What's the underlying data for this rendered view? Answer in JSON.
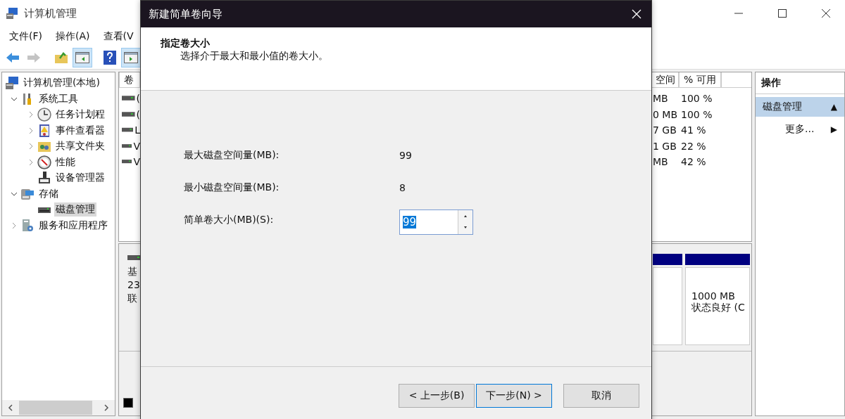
{
  "window": {
    "title": "计算机管理"
  },
  "menu": [
    {
      "label": "文件(F)"
    },
    {
      "label": "操作(A)"
    },
    {
      "label": "查看(V"
    }
  ],
  "toolbar": [
    {
      "pressed": false,
      "disabled": false
    },
    {
      "pressed": false,
      "disabled": true
    },
    {
      "pressed": false,
      "disabled": false
    },
    {
      "pressed": true,
      "disabled": false
    },
    {
      "pressed": false,
      "disabled": false
    },
    {
      "pressed": true,
      "disabled": false
    }
  ],
  "tree": [
    {
      "label": "计算机管理(本地)",
      "selected": false,
      "children": [
        {
          "label": "系统工具",
          "expanded": true,
          "selected": false,
          "children": [
            {
              "label": "任务计划程",
              "expanded": false,
              "selected": false
            },
            {
              "label": "事件查看器",
              "expanded": false,
              "selected": false
            },
            {
              "label": "共享文件夹",
              "expanded": false,
              "selected": false
            },
            {
              "label": "性能",
              "expanded": false,
              "selected": false
            },
            {
              "label": "设备管理器",
              "selected": false
            }
          ]
        },
        {
          "label": "存储",
          "expanded": true,
          "selected": false,
          "children": [
            {
              "label": "磁盘管理",
              "selected": true
            }
          ]
        },
        {
          "label": "服务和应用程序",
          "expanded": false,
          "selected": false
        }
      ]
    }
  ],
  "volumes": {
    "columns": [
      {
        "label": "卷"
      },
      {
        "label": "空间"
      },
      {
        "label": "% 可用"
      }
    ],
    "rows": [
      {
        "volume": "(",
        "free": "MB",
        "percent": "100 %"
      },
      {
        "volume": "(",
        "free": "0 MB",
        "percent": "100 %"
      },
      {
        "volume": "L",
        "free": "7 GB",
        "percent": "41 %"
      },
      {
        "volume": "V",
        "free": "1 GB",
        "percent": "22 %"
      },
      {
        "volume": "V",
        "free": "MB",
        "percent": "42 %"
      }
    ]
  },
  "disk": {
    "lines": [
      "基",
      "23",
      "联"
    ],
    "partition": {
      "lines": [
        "1000 MB",
        "状态良好 (C"
      ]
    }
  },
  "actions": {
    "title": "操作",
    "items": [
      {
        "kind": "section",
        "label": "磁盘管理",
        "arrow": "▲",
        "selected": true
      },
      {
        "kind": "item",
        "label": "更多...",
        "arrow": "▶",
        "selected": false
      }
    ]
  },
  "dialog": {
    "title": "新建简单卷向导",
    "heading": "指定卷大小",
    "subtitle": "选择介于最大和最小值的卷大小。",
    "fields": [
      {
        "kind": "value",
        "label": "最大磁盘空间量(MB):",
        "value": "99"
      },
      {
        "kind": "value",
        "label": "最小磁盘空间量(MB):",
        "value": "8"
      },
      {
        "kind": "spinner",
        "label": "简单卷大小(MB)(S):",
        "value": "99",
        "value_selected": true
      }
    ],
    "buttons": [
      {
        "label": "< 上一步(B)",
        "default": false
      },
      {
        "label": "下一步(N) >",
        "default": true
      },
      {
        "label": "取消",
        "default": false
      }
    ]
  }
}
